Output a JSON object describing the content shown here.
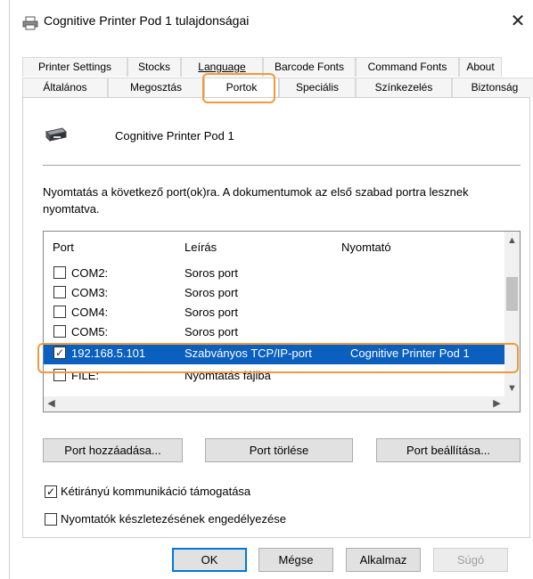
{
  "window": {
    "title": "Cognitive Printer Pod 1 tulajdonságai",
    "close_glyph": "✕"
  },
  "tabs": {
    "top": [
      "Printer Settings",
      "Stocks",
      "Language",
      "Barcode Fonts",
      "Command Fonts",
      "About"
    ],
    "bottom": [
      "Általános",
      "Megosztás",
      "Portok",
      "Speciális",
      "Színkezelés",
      "Biztonság"
    ],
    "active": "Portok"
  },
  "printer": {
    "name": "Cognitive Printer Pod 1",
    "icon": "printer-icon"
  },
  "description": "Nyomtatás a következő port(ok)ra. A dokumentumok az első szabad portra lesznek nyomtatva.",
  "port_list": {
    "headers": [
      "Port",
      "Leírás",
      "Nyomtató"
    ],
    "rows": [
      {
        "checked": false,
        "port": "COM2:",
        "desc": "Soros port",
        "printer": ""
      },
      {
        "checked": false,
        "port": "COM3:",
        "desc": "Soros port",
        "printer": ""
      },
      {
        "checked": false,
        "port": "COM4:",
        "desc": "Soros port",
        "printer": ""
      },
      {
        "checked": false,
        "port": "COM5:",
        "desc": "Soros port",
        "printer": ""
      },
      {
        "checked": true,
        "port": "192.168.5.101",
        "desc": "Szabványos TCP/IP-port",
        "printer": "Cognitive Printer Pod 1"
      },
      {
        "checked": false,
        "port": "FILE:",
        "desc": "Nyomtatás fájlba",
        "printer": ""
      }
    ]
  },
  "buttons": {
    "add_port": "Port hozzáadása...",
    "delete_port": "Port törlése",
    "configure_port": "Port beállítása..."
  },
  "options": {
    "bidirectional": {
      "label": "Kétirányú kommunikáció támogatása",
      "checked": true
    },
    "pooling": {
      "label": "Nyomtatók készletezésének engedélyezése",
      "checked": false
    }
  },
  "footer": {
    "ok": "OK",
    "cancel": "Mégse",
    "apply": "Alkalmaz",
    "help": "Súgó"
  },
  "colors": {
    "highlight": "#f29a3b",
    "selection": "#0a5fbf"
  }
}
